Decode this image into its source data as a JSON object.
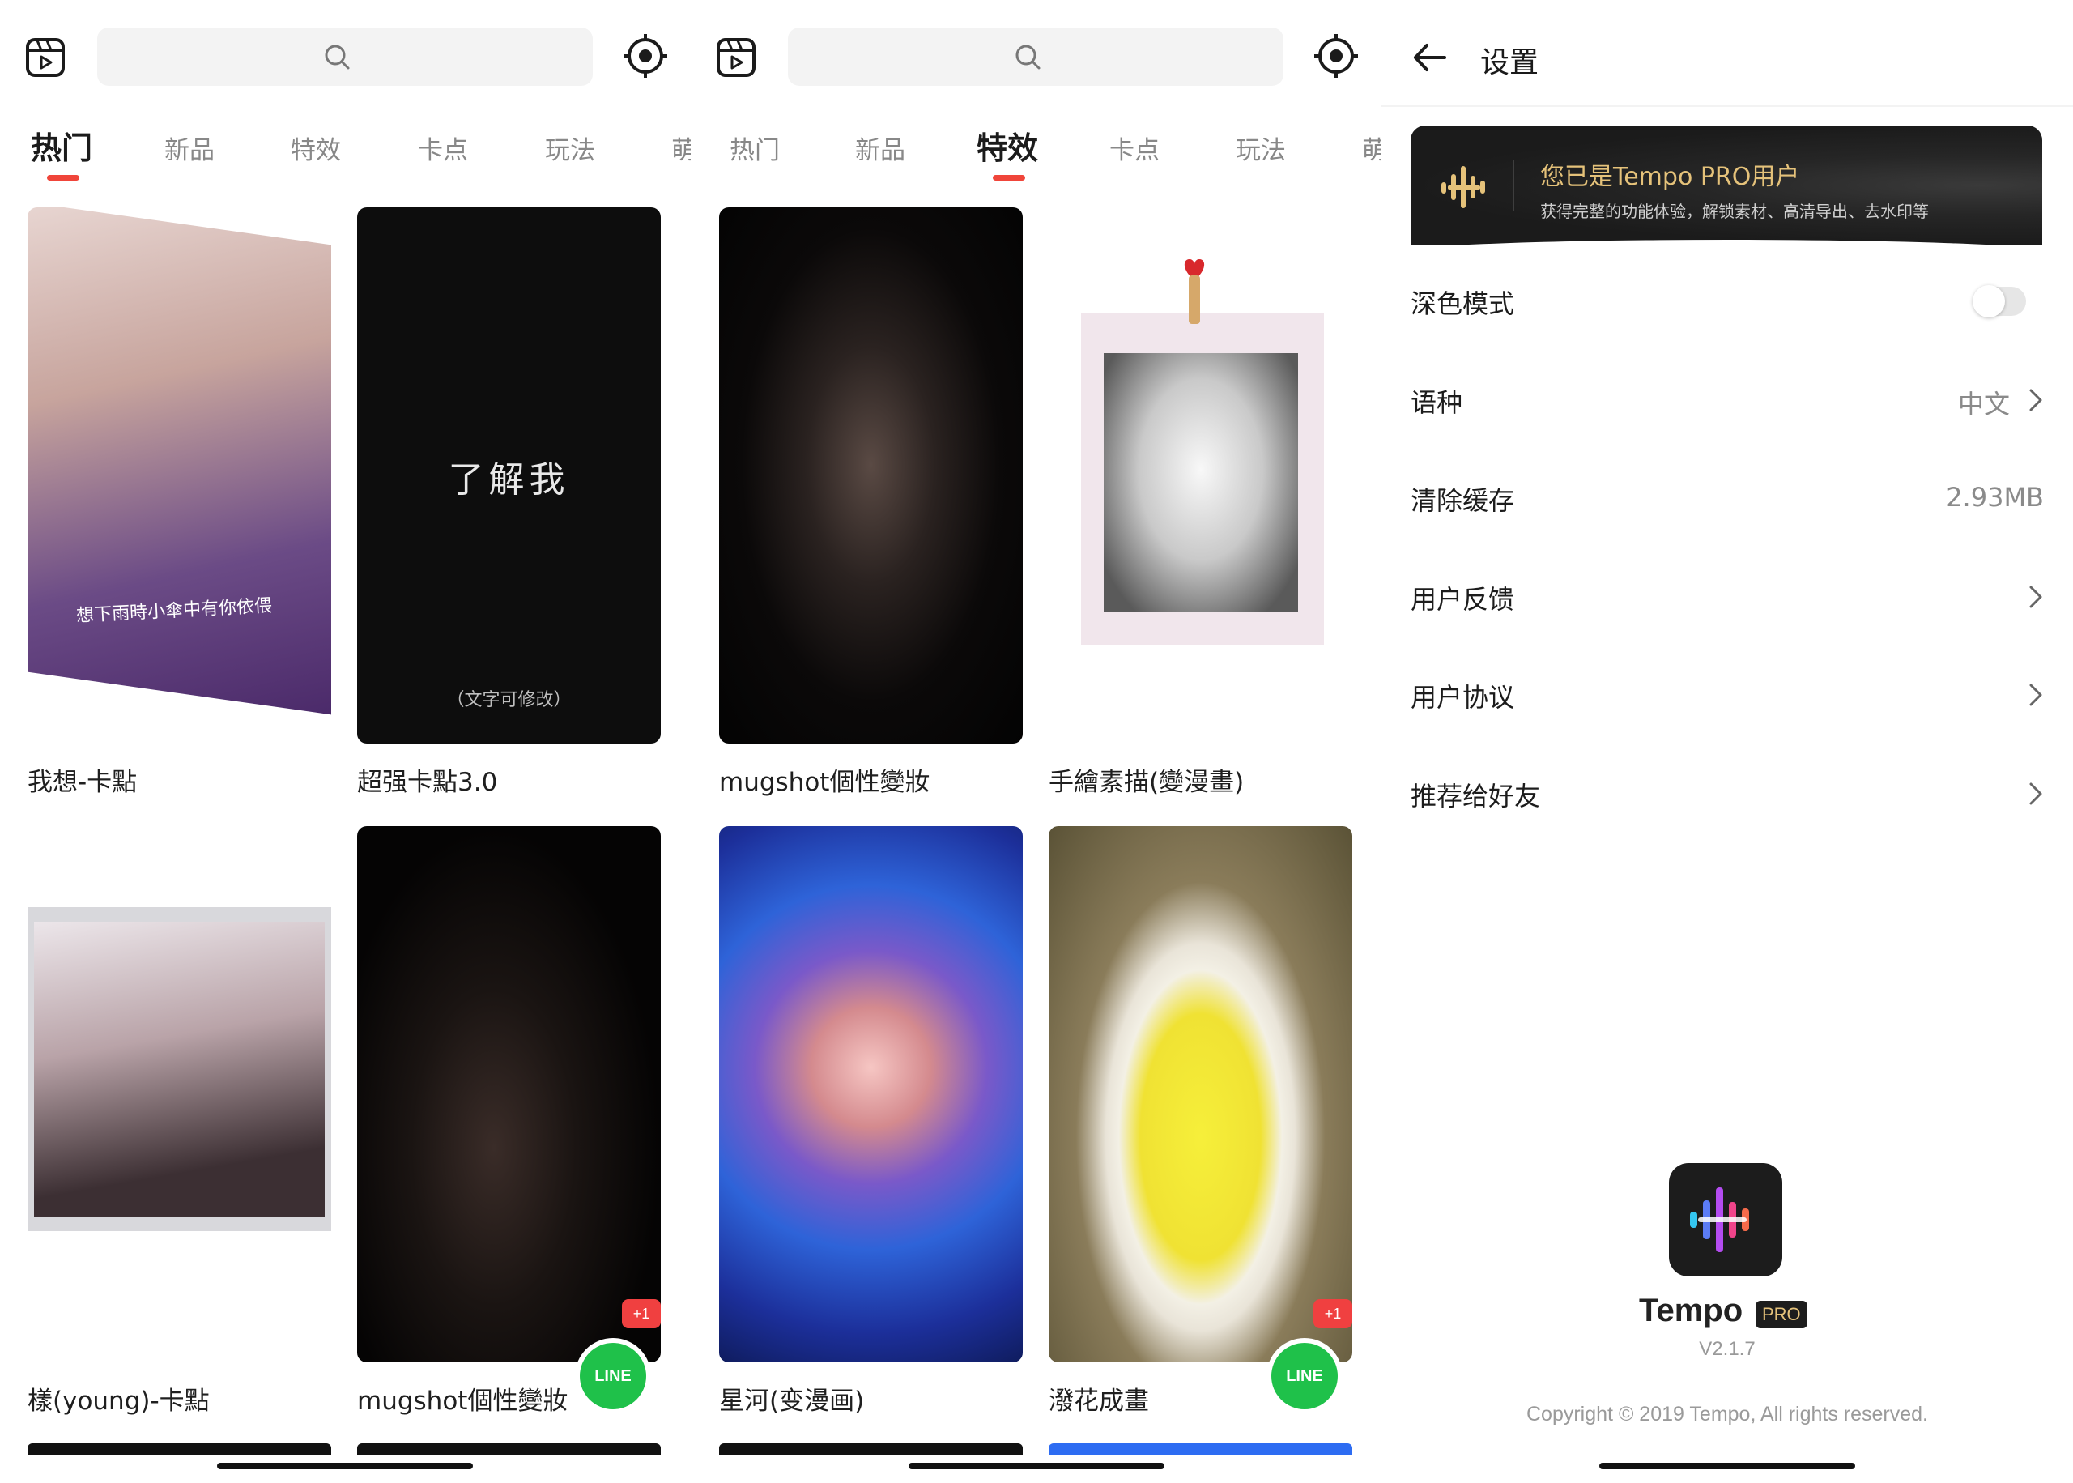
{
  "colors": {
    "accent_red": "#f0453a",
    "line_green": "#1fc14a",
    "pro_gold": "#e5c27a"
  },
  "left": {
    "tabs": [
      {
        "label": "热门"
      },
      {
        "label": "新品"
      },
      {
        "label": "特效"
      },
      {
        "label": "卡点"
      },
      {
        "label": "玩法"
      },
      {
        "label": "萌"
      }
    ],
    "active_tab": "热门",
    "cards": [
      {
        "caption": "我想-卡點",
        "overlay_text": "想下雨時小傘中有你依偎"
      },
      {
        "caption": "超强卡點3.0",
        "thumb_title": "了解我",
        "thumb_note": "（文字可修改）"
      },
      {
        "caption": "樣(young)-卡點"
      },
      {
        "caption": "mugshot個性變妝",
        "plus_badge": "+1",
        "share_badge": "LINE"
      }
    ]
  },
  "mid": {
    "tabs": [
      {
        "label": "热门"
      },
      {
        "label": "新品"
      },
      {
        "label": "特效"
      },
      {
        "label": "卡点"
      },
      {
        "label": "玩法"
      },
      {
        "label": "萌"
      }
    ],
    "active_tab": "特效",
    "cards": [
      {
        "caption": "mugshot個性變妝"
      },
      {
        "caption": "手繪素描(變漫畫)"
      },
      {
        "caption": "星河(变漫画)"
      },
      {
        "caption": "潑花成畫",
        "plus_badge": "+1",
        "share_badge": "LINE"
      }
    ]
  },
  "settings": {
    "title": "设置",
    "pro_banner": {
      "title": "您已是Tempo PRO用户",
      "subtitle": "获得完整的功能体验，解锁素材、高清导出、去水印等"
    },
    "rows": [
      {
        "label": "深色模式",
        "type": "toggle",
        "toggle_on": false
      },
      {
        "label": "语种",
        "value": "中文",
        "type": "chevron"
      },
      {
        "label": "清除缓存",
        "value": "2.93MB",
        "type": "value"
      },
      {
        "label": "用户反馈",
        "type": "chevron"
      },
      {
        "label": "用户协议",
        "type": "chevron"
      },
      {
        "label": "推荐给好友",
        "type": "chevron"
      }
    ],
    "brand": {
      "name": "Tempo",
      "tag": "PRO",
      "version": "V2.1.7"
    },
    "copyright": "Copyright © 2019 Tempo, All rights reserved."
  }
}
